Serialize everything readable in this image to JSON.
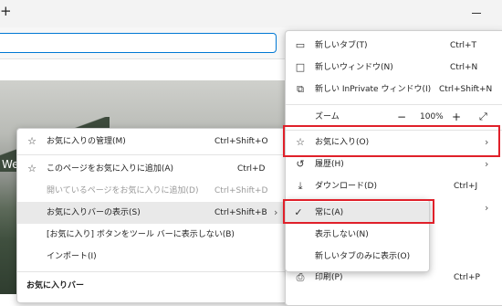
{
  "browser": {
    "new_tab_glyph": "+",
    "hero_text": "We"
  },
  "main_menu": {
    "items": [
      {
        "label": "新しいタブ(T)",
        "shortcut": "Ctrl+T",
        "icon": "new-tab-icon"
      },
      {
        "label": "新しいウィンドウ(N)",
        "shortcut": "Ctrl+N",
        "icon": "new-window-icon"
      },
      {
        "label": "新しい InPrivate ウィンドウ(I)",
        "shortcut": "Ctrl+Shift+N",
        "icon": "inprivate-window-icon"
      }
    ],
    "zoom": {
      "label": "ズーム",
      "minus": "−",
      "value": "100%",
      "plus": "+"
    },
    "favorites": {
      "label": "お気に入り(O)",
      "icon": "favorites-icon"
    },
    "history": {
      "label": "履歴(H)",
      "icon": "history-icon"
    },
    "downloads": {
      "label": "ダウンロード(D)",
      "shortcut": "Ctrl+J",
      "icon": "download-icon"
    },
    "print": {
      "label": "印刷(P)",
      "shortcut": "Ctrl+P",
      "icon": "print-icon"
    }
  },
  "favorites_menu": {
    "items": [
      {
        "label": "お気に入りの管理(M)",
        "shortcut": "Ctrl+Shift+O",
        "disabled": false
      },
      {
        "label": "このページをお気に入りに追加(A)",
        "shortcut": "Ctrl+D",
        "disabled": false
      },
      {
        "label": "開いているページをお気に入りに追加(D)",
        "shortcut": "Ctrl+Shift+D",
        "disabled": true
      },
      {
        "label": "お気に入りバーの表示(S)",
        "shortcut": "Ctrl+Shift+B",
        "disabled": false
      },
      {
        "label": "[お気に入り] ボタンをツール バーに表示しない(B)",
        "shortcut": "",
        "disabled": false
      },
      {
        "label": "インポート(I)",
        "shortcut": "",
        "disabled": false
      }
    ],
    "section_header": "お気に入りバー"
  },
  "bar_submenu": {
    "items": [
      {
        "label": "常に(A)",
        "checked": true
      },
      {
        "label": "表示しない(N)",
        "checked": false
      },
      {
        "label": "新しいタブのみに表示(O)",
        "checked": false
      }
    ]
  },
  "colors": {
    "highlight_box": "#e0202a",
    "accent": "#0078d4"
  }
}
